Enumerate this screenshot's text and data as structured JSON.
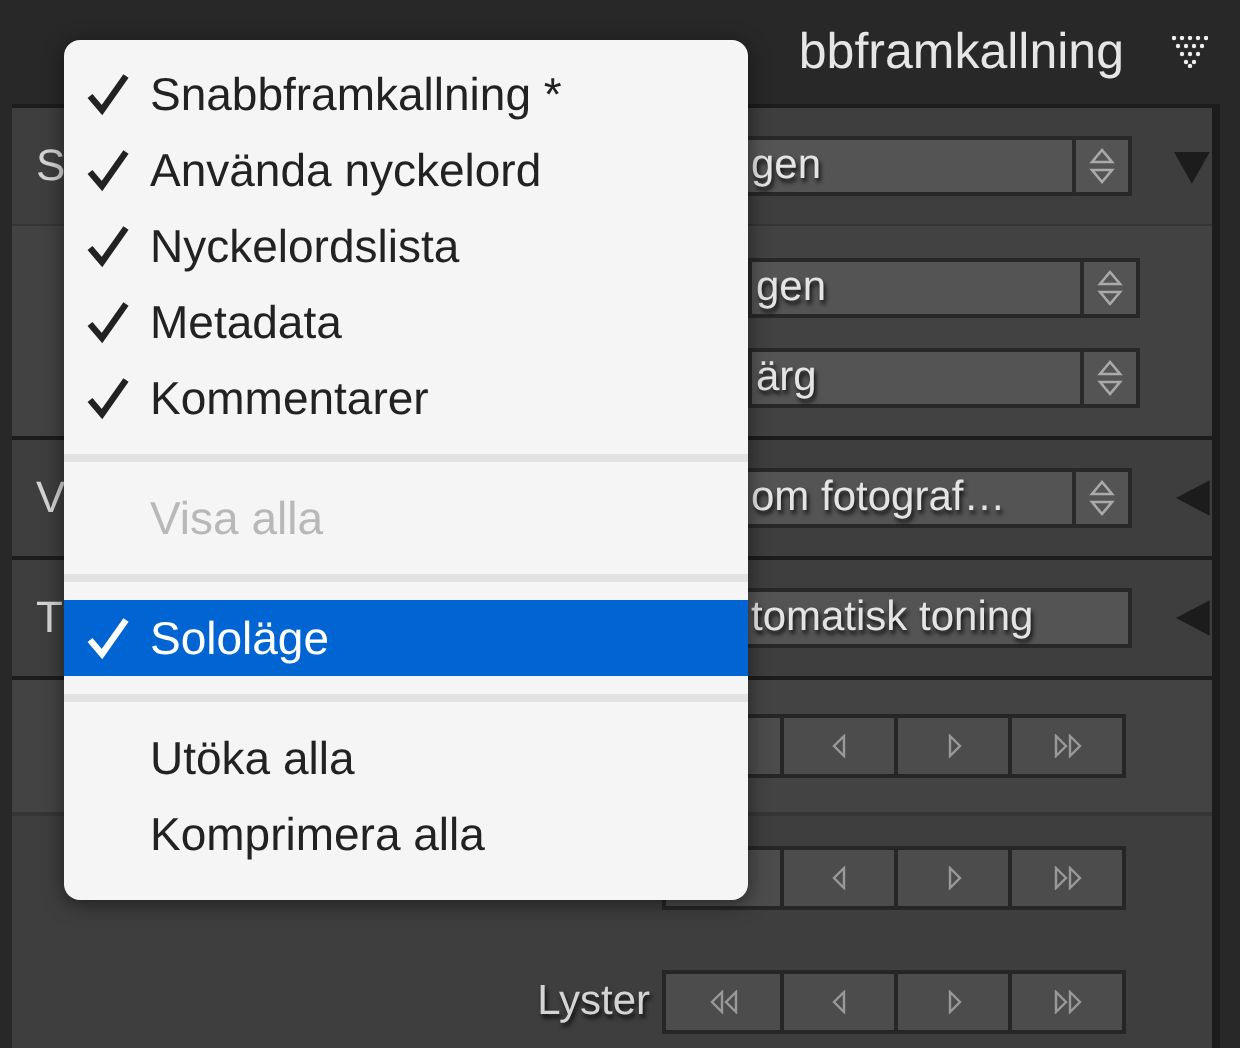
{
  "header": {
    "title": "bbframkallning"
  },
  "sections": [
    {
      "label": "S",
      "expanded": true,
      "value": "gen",
      "stepper": true,
      "sub_dropdowns": [
        {
          "value": "gen",
          "stepper": true
        },
        {
          "value": "ärg",
          "stepper": true
        }
      ]
    },
    {
      "label": "V",
      "expanded": false,
      "value": "om fotograf…",
      "stepper": true
    },
    {
      "label": "T",
      "expanded": false,
      "value": "tomatisk toning",
      "stepper": false
    }
  ],
  "adjust_rows": [
    {
      "shaded": true
    },
    {
      "shaded": false
    },
    {
      "shaded": false,
      "label": "Lyster"
    }
  ],
  "menu": [
    {
      "kind": "item",
      "label": "Snabbframkallning *",
      "checked": true,
      "disabled": false,
      "selected": false
    },
    {
      "kind": "item",
      "label": "Använda nyckelord",
      "checked": true,
      "disabled": false,
      "selected": false
    },
    {
      "kind": "item",
      "label": "Nyckelordslista",
      "checked": true,
      "disabled": false,
      "selected": false
    },
    {
      "kind": "item",
      "label": "Metadata",
      "checked": true,
      "disabled": false,
      "selected": false
    },
    {
      "kind": "item",
      "label": "Kommentarer",
      "checked": true,
      "disabled": false,
      "selected": false
    },
    {
      "kind": "separator"
    },
    {
      "kind": "item",
      "label": "Visa alla",
      "checked": false,
      "disabled": true,
      "selected": false
    },
    {
      "kind": "separator"
    },
    {
      "kind": "item",
      "label": "Sololäge",
      "checked": true,
      "disabled": false,
      "selected": true
    },
    {
      "kind": "separator"
    },
    {
      "kind": "item",
      "label": "Utöka alla",
      "checked": false,
      "disabled": false,
      "selected": false
    },
    {
      "kind": "item",
      "label": "Komprimera alla",
      "checked": false,
      "disabled": false,
      "selected": false
    }
  ]
}
